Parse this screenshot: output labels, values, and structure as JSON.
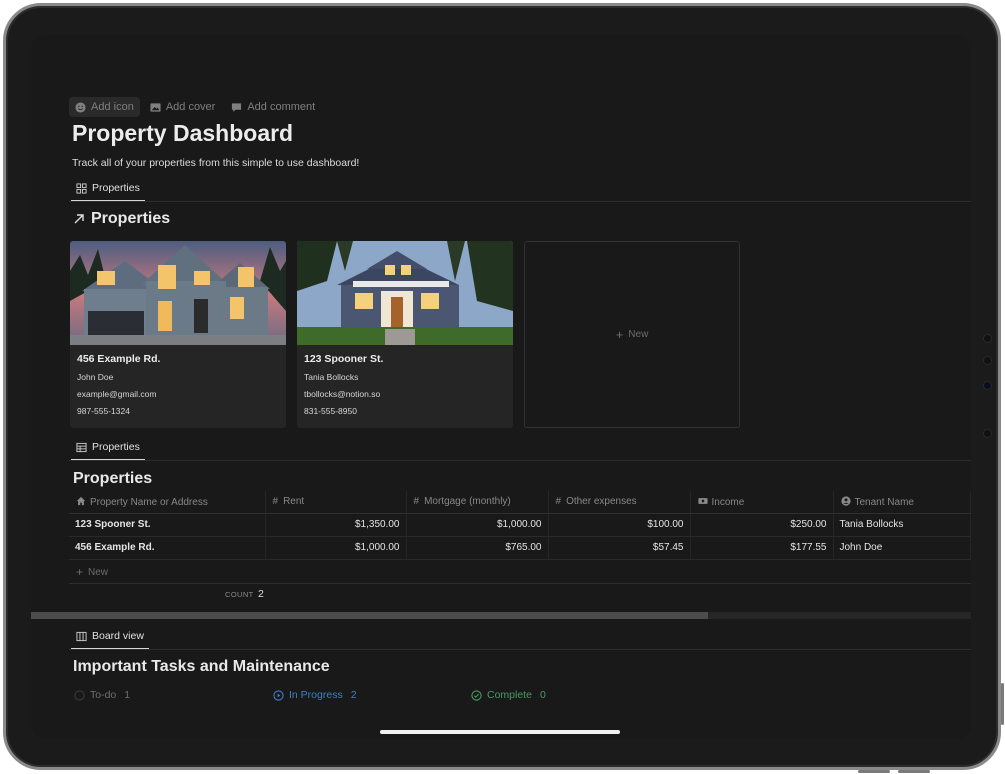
{
  "page": {
    "actions": [
      {
        "label": "Add icon",
        "icon": "smiley-icon"
      },
      {
        "label": "Add cover",
        "icon": "image-icon"
      },
      {
        "label": "Add comment",
        "icon": "comment-icon"
      }
    ],
    "title": "Property Dashboard",
    "description": "Track all of your properties from this simple to use dashboard!"
  },
  "gallery": {
    "view_tab": "Properties",
    "title": "Properties",
    "cards": [
      {
        "address": "456 Example Rd.",
        "tenant": "John Doe",
        "email": "example@gmail.com",
        "phone": "987-555-1324"
      },
      {
        "address": "123 Spooner St.",
        "tenant": "Tania Bollocks",
        "email": "tbollocks@notion.so",
        "phone": "831-555-8950"
      }
    ],
    "new_label": "New"
  },
  "table": {
    "view_tab": "Properties",
    "title": "Properties",
    "columns": [
      "Property Name or Address",
      "Rent",
      "Mortgage (monthly)",
      "Other expenses",
      "Income",
      "Tenant Name"
    ],
    "rows": [
      [
        "123 Spooner St.",
        "$1,350.00",
        "$1,000.00",
        "$100.00",
        "$250.00",
        "Tania Bollocks"
      ],
      [
        "456 Example Rd.",
        "$1,000.00",
        "$765.00",
        "$57.45",
        "$177.55",
        "John Doe"
      ]
    ],
    "new_label": "New",
    "count_label": "COUNT",
    "count_value": "2"
  },
  "board": {
    "view_tab": "Board view",
    "title": "Important Tasks and Maintenance",
    "groups": [
      {
        "label": "To-do",
        "count": "1",
        "color": "#6e6e6e"
      },
      {
        "label": "In Progress",
        "count": "2",
        "color": "#3f7fc4"
      },
      {
        "label": "Complete",
        "count": "0",
        "color": "#4a9a62"
      }
    ]
  },
  "colors": {
    "background": "#191919",
    "card": "#252525",
    "accent_blue": "#3f7fc4",
    "accent_green": "#4a9a62"
  }
}
